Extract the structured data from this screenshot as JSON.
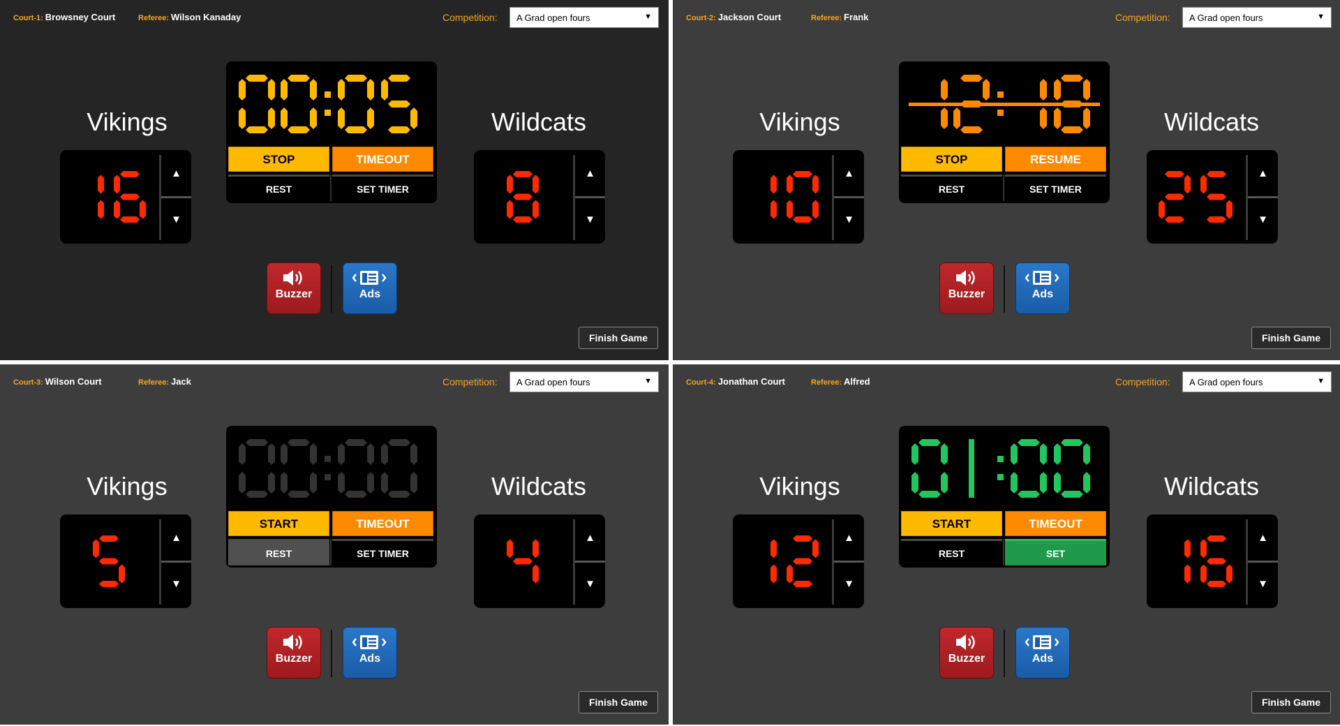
{
  "labels": {
    "court_prefix_suffix": ":",
    "referee_label": "Referee:",
    "competition_label": "Competition:",
    "finish": "Finish Game",
    "buzzer": "Buzzer",
    "ads": "Ads",
    "rest": "REST"
  },
  "icons": {
    "buzzer": "speaker-volume-icon",
    "ads": "ad-panel-icon",
    "up": "triangle-up-icon",
    "down": "triangle-down-icon",
    "dropdown": "triangle-down-small-icon"
  },
  "colors": {
    "score_digit": "#ff2a00",
    "timer_yellow": "#ffba00",
    "timer_orange": "#ff8a00",
    "timer_green": "#22c55e",
    "timer_off": "#333333",
    "label_accent": "#f5a623",
    "buzzer_red": "#b02024",
    "ads_blue": "#2268b8",
    "set_green": "#1e9a4a"
  },
  "courts": [
    {
      "court_id": "Court-1",
      "court_name": "Browsney Court",
      "referee": "Wilson Kanaday",
      "competition": "A Grad open fours",
      "team_left": "Vikings",
      "team_right": "Wildcats",
      "score_left": "16",
      "score_right": "8",
      "timer_text": "00:05",
      "timer_color": "yellow",
      "timer_strike": false,
      "btn_primary": "STOP",
      "btn_secondary": "TIMEOUT",
      "btn_set": "SET TIMER",
      "rest_highlight": false,
      "set_green": false,
      "background": "dark"
    },
    {
      "court_id": "Court-2",
      "court_name": "Jackson Court",
      "referee": "Frank",
      "competition": "A Grad open fours",
      "team_left": "Vikings",
      "team_right": "Wildcats",
      "score_left": "10",
      "score_right": "25",
      "timer_text": "12:18",
      "timer_color": "orange",
      "timer_strike": true,
      "btn_primary": "STOP",
      "btn_secondary": "RESUME",
      "btn_set": "SET TIMER",
      "rest_highlight": false,
      "set_green": false,
      "background": "mid"
    },
    {
      "court_id": "Court-3",
      "court_name": "Wilson Court",
      "referee": "Jack",
      "competition": "A Grad open fours",
      "team_left": "Vikings",
      "team_right": "Wildcats",
      "score_left": "5",
      "score_right": "4",
      "timer_text": "00:00",
      "timer_color": "off",
      "timer_strike": false,
      "btn_primary": "START",
      "btn_secondary": "TIMEOUT",
      "btn_set": "SET TIMER",
      "rest_highlight": true,
      "set_green": false,
      "background": "mid"
    },
    {
      "court_id": "Court-4",
      "court_name": "Jonathan Court",
      "referee": "Alfred",
      "competition": "A Grad open fours",
      "team_left": "Vikings",
      "team_right": "Wildcats",
      "score_left": "12",
      "score_right": "16",
      "timer_text": "0|:00",
      "timer_color": "green",
      "timer_strike": false,
      "btn_primary": "START",
      "btn_secondary": "TIMEOUT",
      "btn_set": "SET",
      "rest_highlight": false,
      "set_green": true,
      "background": "mid"
    }
  ]
}
